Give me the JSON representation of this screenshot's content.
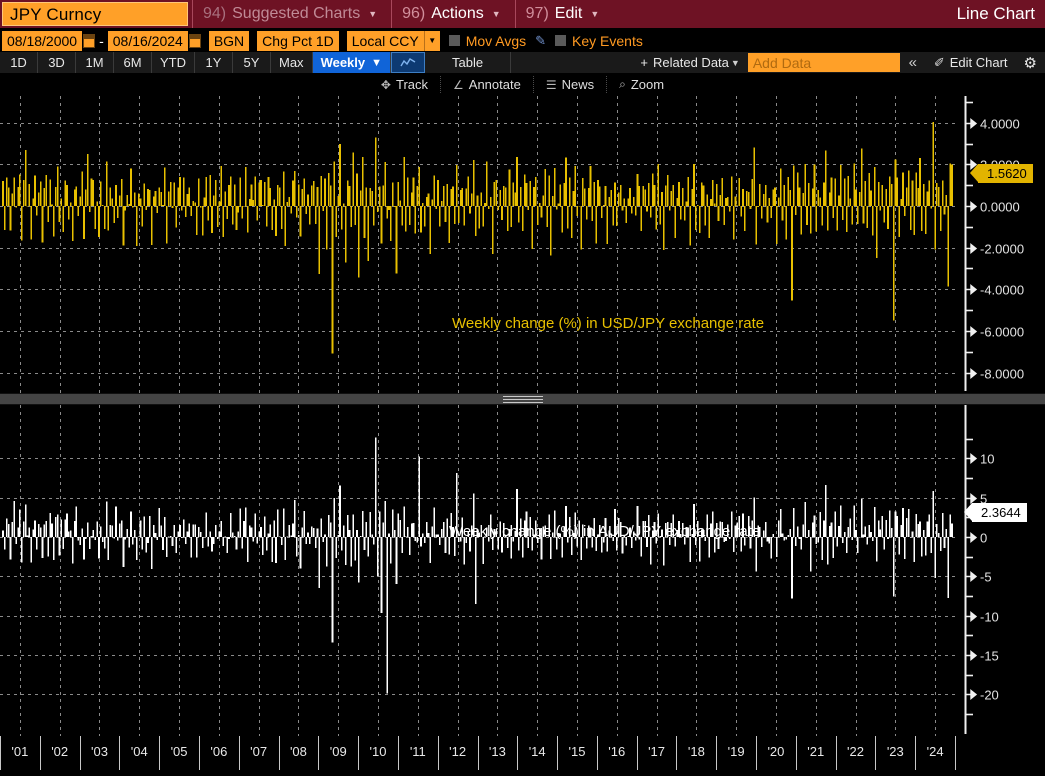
{
  "titlebar": {
    "ticker": "JPY Curncy",
    "items": [
      {
        "num": "94)",
        "label": "Suggested Charts",
        "dim": true,
        "caret": true
      },
      {
        "num": "96)",
        "label": "Actions",
        "dim": false,
        "caret": true
      },
      {
        "num": "97)",
        "label": "Edit",
        "dim": false,
        "caret": true
      }
    ],
    "chart_type": "Line Chart"
  },
  "parambar": {
    "date_from": "08/18/2000",
    "date_to": "08/16/2024",
    "separator": "-",
    "source": "BGN",
    "transform": "Chg Pct 1D",
    "currency": "Local CCY",
    "mov_avgs_label": "Mov Avgs",
    "key_events_label": "Key Events"
  },
  "periodbar": {
    "periods": [
      "1D",
      "3D",
      "1M",
      "6M",
      "YTD",
      "1Y",
      "5Y",
      "Max"
    ],
    "frequency": "Weekly",
    "table_label": "Table",
    "related_data": "Related Data",
    "add_data_placeholder": "Add Data",
    "collapse_label": "«",
    "edit_chart": "Edit Chart"
  },
  "toolbar": {
    "tools": [
      {
        "icon": "crosshair-icon",
        "label": "Track"
      },
      {
        "icon": "annotate-icon",
        "label": "Annotate"
      },
      {
        "icon": "news-icon",
        "label": "News"
      },
      {
        "icon": "zoom-icon",
        "label": "Zoom"
      }
    ]
  },
  "panels": {
    "top": {
      "annotation": "Weekly change (%) in USD/JPY exchange rate",
      "badge_value": "1.5620",
      "badge_color": "#e2b400",
      "series_color": "#e8c000"
    },
    "bottom": {
      "annotation": "Weekly change (%) in AUD/JPY exchange rate",
      "badge_value": "2.3644",
      "badge_color": "#ffffff",
      "series_color": "#ffffff"
    }
  },
  "xaxis": {
    "labels": [
      "'01",
      "'02",
      "'03",
      "'04",
      "'05",
      "'06",
      "'07",
      "'08",
      "'09",
      "'10",
      "'11",
      "'12",
      "'13",
      "'14",
      "'15",
      "'16",
      "'17",
      "'18",
      "'19",
      "'20",
      "'21",
      "'22",
      "'23",
      "'24"
    ]
  },
  "chart_data": [
    {
      "type": "bar",
      "id": "usdjpy-weekly-change",
      "title": "Weekly change (%) in USD/JPY exchange rate",
      "xlabel": "",
      "ylabel": "",
      "ylim": [
        -8.6,
        4.9
      ],
      "yticks": [
        4.0,
        2.0,
        0.0,
        -2.0,
        -4.0,
        -6.0,
        -8.0
      ],
      "ytick_labels": [
        "4.0000",
        "2.0000",
        "0.0000",
        "-2.0000",
        "-4.0000",
        "-6.0000",
        "-8.0000"
      ],
      "grid": true,
      "color": "#e8c000",
      "last_value": 1.562,
      "x_start": "2000-08-18",
      "x_end": "2024-08-16",
      "frequency": "Weekly",
      "categories": [
        "'01",
        "'02",
        "'03",
        "'04",
        "'05",
        "'06",
        "'07",
        "'08",
        "'09",
        "'10",
        "'11",
        "'12",
        "'13",
        "'14",
        "'15",
        "'16",
        "'17",
        "'18",
        "'19",
        "'20",
        "'21",
        "'22",
        "'23",
        "'24"
      ],
      "values": [
        0.6,
        -0.9,
        1.4,
        0.5,
        -1.2,
        0.8,
        1.9,
        -0.4,
        0.3,
        1.1,
        -1.6,
        0.7,
        2.2,
        -0.6,
        0.9,
        -1.3,
        0.4,
        1.7,
        -0.8,
        0.2,
        1.0,
        -2.1,
        0.5,
        1.3,
        -0.7,
        1.8,
        0.3,
        -1.1,
        0.6,
        2.4,
        -0.5,
        0.9,
        -1.4,
        0.7,
        1.2,
        -0.3,
        0.8,
        -1.9,
        0.4,
        1.5,
        -0.6,
        0.2,
        1.1,
        -1.0,
        0.7,
        2.0,
        -0.4,
        0.9,
        1.3,
        -0.8,
        0.5,
        -1.5,
        0.9,
        0.3,
        -0.6,
        1.7,
        -1.1,
        0.4,
        0.8,
        -0.2,
        1.4,
        -0.9,
        0.6,
        1.0,
        -1.8,
        0.3,
        0.7,
        -0.5,
        1.2,
        -0.4,
        0.9,
        -1.3,
        0.5,
        0.8,
        -1.0,
        1.5,
        -0.6,
        0.3,
        1.1,
        -2.2,
        0.7,
        0.4,
        -0.9,
        1.3,
        0.2,
        -0.5,
        1.8,
        -1.2,
        0.6,
        0.9,
        -0.3,
        1.0,
        -1.6,
        0.5,
        0.8,
        -0.7,
        1.4,
        -0.4,
        0.9,
        1.2,
        -1.1,
        0.3,
        0.6,
        -0.8,
        1.5,
        0.2,
        -1.3,
        0.7,
        1.0,
        -0.5,
        0.9,
        -1.7,
        0.4,
        1.1,
        -0.6,
        0.8,
        1.3,
        -0.9,
        0.5,
        -1.2,
        0.7,
        1.6,
        -0.4,
        0.9,
        -1.0,
        0.3,
        1.2,
        -0.7,
        0.5,
        2.1,
        -1.4,
        0.6,
        0.9,
        -0.3,
        1.0,
        -1.1,
        0.8,
        1.4,
        -0.5,
        0.7,
        -0.9,
        1.2,
        0.4,
        -1.6,
        0.8,
        -2.0,
        1.1,
        0.5,
        -0.8,
        1.7,
        -1.3,
        0.6,
        0.9,
        -0.4,
        1.0,
        2.3,
        -0.7,
        0.5,
        -1.5,
        0.8,
        1.2,
        -0.6,
        0.9,
        -1.0,
        0.4,
        1.6,
        -0.8,
        0.7,
        -3.1,
        1.9,
        -0.5,
        0.8,
        -2.4,
        1.1,
        0.6,
        -7.2,
        2.6,
        -1.8,
        0.9,
        3.4,
        -1.2,
        0.7,
        -2.9,
        1.5,
        0.4,
        -1.6,
        2.0,
        -0.8,
        1.2,
        -3.6,
        0.9,
        2.8,
        -1.1,
        0.6,
        -2.2,
        1.4,
        0.8,
        -1.0,
        3.9,
        -0.5,
        1.1,
        -1.9,
        0.7,
        2.1,
        -0.9,
        0.4,
        -1.4,
        1.6,
        0.5,
        -2.7,
        1.0,
        0.8,
        -1.2,
        1.8,
        -0.6,
        0.9,
        -1.5,
        0.7,
        1.3,
        -0.8,
        0.4,
        2.2,
        -1.1,
        0.6,
        -0.9,
        1.0,
        0.3,
        -1.7,
        0.8,
        1.5,
        -0.5,
        0.9,
        -1.2,
        0.6,
        1.1,
        -0.4,
        0.7,
        -2.0,
        1.3,
        0.5,
        -0.8,
        1.9,
        -1.0,
        0.6,
        0.9,
        -1.4,
        0.4,
        1.2,
        -0.7,
        0.8,
        2.5,
        -1.1,
        0.5,
        -0.6,
        1.0,
        -1.3,
        0.7,
        1.6,
        -0.4,
        0.9,
        -1.8,
        0.6,
        1.1,
        -0.5,
        0.8,
        -1.0,
        1.4,
        0.3,
        -0.7,
        1.2,
        -1.5,
        0.6,
        0.9,
        2.8,
        -1.2,
        0.5,
        -0.8,
        1.0,
        1.7,
        -0.4,
        0.7,
        -1.9,
        0.9,
        1.3,
        -0.6,
        0.4,
        -1.1,
        0.8,
        1.5,
        -0.5,
        0.9,
        -2.3,
        0.6,
        1.2,
        -0.8,
        0.3,
        1.0,
        -1.4,
        0.7,
        1.8,
        -0.5,
        0.9,
        -1.0,
        0.4,
        1.3,
        -0.7,
        0.6,
        -1.6,
        1.1,
        0.5,
        -0.9,
        0.8,
        1.4,
        -0.3,
        0.7,
        -1.2,
        0.9,
        1.0,
        -0.6,
        0.4,
        1.5,
        -1.8,
        0.8,
        0.5,
        -1.0,
        1.2,
        -0.4,
        0.9,
        1.6,
        -0.7,
        0.3,
        -1.3,
        0.8,
        1.1,
        -0.5,
        0.6,
        -0.9,
        1.4,
        0.4,
        -1.5,
        0.9,
        1.0,
        -0.6,
        0.7,
        -1.1,
        1.3,
        0.5,
        -0.8,
        1.7,
        -0.4,
        0.9,
        -1.6,
        0.6,
        1.2,
        -0.7,
        0.3,
        1.0,
        -1.2,
        0.8,
        1.5,
        -0.5,
        0.9,
        -0.8,
        0.4,
        1.1,
        -1.4,
        0.7,
        1.8,
        -0.6,
        0.5,
        -1.0,
        0.9,
        1.3,
        -0.4,
        0.8,
        -1.7,
        0.6,
        1.0,
        -0.5,
        1.2,
        -0.9,
        0.7,
        1.6,
        -1.3,
        0.4,
        0.9,
        -0.6,
        1.1,
        -1.5,
        0.8,
        0.5,
        1.4,
        -0.7,
        0.9,
        -1.1,
        0.6,
        1.0,
        -0.4,
        0.7,
        2.4,
        -1.8,
        0.5,
        0.9,
        -1.2,
        0.8,
        1.3,
        -0.6,
        0.4,
        -0.9,
        1.1,
        0.7,
        -1.4,
        0.9,
        1.5,
        -0.5,
        0.6,
        -1.0,
        0.8,
        1.2,
        -4.5,
        2.1,
        -0.8,
        1.6,
        0.5,
        -1.3,
        0.9,
        2.0,
        -0.6,
        1.1,
        -1.7,
        0.7,
        1.4,
        -0.9,
        0.5,
        1.0,
        -1.2,
        0.8,
        3.2,
        -1.5,
        0.6,
        0.9,
        -0.7,
        1.3,
        -1.0,
        0.4,
        1.8,
        -0.5,
        0.8,
        -1.4,
        1.1,
        0.6,
        -0.9,
        1.5,
        0.3,
        -1.1,
        0.9,
        2.2,
        -0.6,
        0.7,
        -1.3,
        1.0,
        0.5,
        -0.8,
        1.6,
        -1.9,
        0.9,
        0.4,
        1.2,
        -0.7,
        0.8,
        -1.0,
        1.4,
        0.6,
        -4.9,
        2.3,
        1.0,
        -1.5,
        0.7,
        1.9,
        -0.9,
        0.5,
        1.3,
        -0.6,
        0.8,
        -1.2,
        1.0,
        0.4,
        1.7,
        -0.8,
        0.9,
        -1.4,
        0.6,
        1.1,
        -0.5,
        3.6,
        -2.6,
        1.2,
        0.8,
        -1.0,
        1.5,
        -0.7,
        0.9,
        -4.3,
        2.0,
        1.562
      ]
    },
    {
      "type": "bar",
      "id": "audjpy-weekly-change",
      "title": "Weekly change (%) in AUD/JPY exchange rate",
      "xlabel": "",
      "ylabel": "",
      "ylim": [
        -23.5,
        15.5
      ],
      "yticks": [
        10,
        5,
        0,
        -5,
        -10,
        -15,
        -20
      ],
      "ytick_labels": [
        "10",
        "5",
        "0",
        "-5",
        "-10",
        "-15",
        "-20"
      ],
      "grid": true,
      "color": "#ffffff",
      "last_value": 2.3644,
      "x_start": "2000-08-18",
      "x_end": "2024-08-16",
      "frequency": "Weekly",
      "categories": [
        "'01",
        "'02",
        "'03",
        "'04",
        "'05",
        "'06",
        "'07",
        "'08",
        "'09",
        "'10",
        "'11",
        "'12",
        "'13",
        "'14",
        "'15",
        "'16",
        "'17",
        "'18",
        "'19",
        "'20",
        "'21",
        "'22",
        "'23",
        "'24"
      ],
      "values": [
        1.2,
        -1.8,
        2.4,
        0.9,
        -2.1,
        1.5,
        3.2,
        -0.8,
        0.6,
        2.0,
        -2.8,
        1.3,
        3.6,
        -1.1,
        1.7,
        -2.3,
        0.8,
        2.9,
        -1.4,
        0.4,
        1.9,
        -3.4,
        0.9,
        2.2,
        -1.3,
        3.0,
        0.6,
        -1.9,
        1.1,
        4.1,
        -0.9,
        1.6,
        -2.4,
        1.2,
        2.1,
        -0.5,
        1.4,
        -3.2,
        0.7,
        2.6,
        -1.0,
        0.4,
        1.9,
        -1.7,
        1.2,
        3.4,
        -0.7,
        1.5,
        2.2,
        -1.4,
        0.9,
        -2.6,
        1.5,
        0.5,
        -1.0,
        2.9,
        -1.9,
        0.7,
        1.4,
        -0.4,
        2.4,
        -1.5,
        1.0,
        1.7,
        -3.0,
        0.5,
        1.2,
        -0.9,
        2.0,
        -0.7,
        1.5,
        -2.2,
        0.9,
        1.4,
        -1.7,
        2.5,
        -1.0,
        0.5,
        1.9,
        -3.7,
        1.2,
        0.7,
        -1.5,
        2.2,
        0.4,
        -0.9,
        3.0,
        -2.0,
        1.0,
        1.5,
        -0.5,
        1.7,
        -2.7,
        0.9,
        1.4,
        -1.2,
        2.4,
        -0.7,
        1.5,
        2.0,
        -1.9,
        0.5,
        1.0,
        -1.4,
        2.5,
        0.4,
        -2.2,
        1.2,
        1.7,
        -0.9,
        1.5,
        -2.9,
        0.7,
        1.9,
        -1.0,
        1.4,
        2.2,
        -1.5,
        0.9,
        -2.0,
        1.2,
        2.7,
        -0.7,
        1.5,
        -1.7,
        0.5,
        2.0,
        -1.2,
        0.9,
        3.5,
        -2.4,
        1.0,
        1.5,
        -0.5,
        1.7,
        -1.9,
        1.4,
        2.4,
        -0.9,
        1.2,
        -1.5,
        2.0,
        0.7,
        -2.7,
        1.4,
        -3.4,
        1.9,
        0.9,
        -1.4,
        2.9,
        -2.2,
        1.0,
        1.5,
        -0.7,
        1.7,
        3.9,
        -1.2,
        0.9,
        -2.5,
        1.4,
        2.0,
        -1.0,
        1.5,
        -1.7,
        0.7,
        2.7,
        -1.4,
        1.2,
        -5.2,
        3.2,
        -0.9,
        1.4,
        -4.0,
        1.9,
        1.0,
        -12.0,
        4.4,
        -3.0,
        1.5,
        5.7,
        -2.0,
        1.2,
        -4.9,
        2.5,
        0.7,
        -2.7,
        3.4,
        -1.4,
        2.0,
        -6.1,
        1.5,
        4.7,
        -1.9,
        1.0,
        -3.7,
        2.4,
        1.4,
        -1.7,
        14.2,
        -5.5,
        2.0,
        -8.2,
        1.2,
        4.0,
        -21.0,
        0.7,
        -2.4,
        2.7,
        0.9,
        -4.6,
        1.7,
        1.4,
        -2.0,
        3.0,
        -1.0,
        1.5,
        -2.5,
        1.2,
        2.2,
        -1.4,
        0.7,
        9.5,
        -1.9,
        1.0,
        -1.5,
        1.7,
        0.5,
        -2.9,
        1.4,
        2.5,
        -0.9,
        1.5,
        -2.0,
        1.0,
        1.9,
        -0.7,
        1.2,
        -3.4,
        2.2,
        0.9,
        -1.4,
        8.2,
        -1.7,
        1.0,
        1.5,
        -2.4,
        0.7,
        2.0,
        -1.2,
        1.4,
        5.3,
        -7.5,
        0.9,
        -1.0,
        1.7,
        -2.2,
        1.2,
        2.7,
        -0.7,
        1.5,
        -3.0,
        1.0,
        1.9,
        -0.9,
        1.4,
        -1.7,
        2.4,
        0.5,
        -1.2,
        2.0,
        -2.5,
        1.0,
        1.5,
        4.8,
        -2.0,
        0.9,
        -1.4,
        1.7,
        2.9,
        -0.7,
        1.2,
        -3.2,
        1.5,
        2.2,
        -1.0,
        0.7,
        -1.9,
        1.4,
        2.5,
        -0.9,
        1.5,
        -3.9,
        1.0,
        2.0,
        -1.4,
        0.5,
        1.7,
        -2.4,
        1.2,
        3.0,
        -0.9,
        1.5,
        -1.7,
        0.7,
        2.2,
        -1.2,
        1.0,
        -2.7,
        1.9,
        0.9,
        -1.5,
        1.4,
        2.4,
        -0.5,
        1.2,
        -2.0,
        1.5,
        1.7,
        -1.0,
        0.7,
        2.5,
        -3.0,
        1.4,
        0.9,
        -1.7,
        2.0,
        -0.7,
        1.5,
        2.7,
        -1.2,
        0.5,
        -2.2,
        1.4,
        1.9,
        -0.9,
        1.0,
        -1.5,
        2.4,
        0.7,
        -2.5,
        1.5,
        1.7,
        -1.0,
        1.2,
        -1.9,
        2.2,
        0.9,
        -1.4,
        2.9,
        -0.7,
        1.5,
        -2.7,
        1.0,
        2.0,
        -1.2,
        0.5,
        1.7,
        -2.0,
        1.4,
        2.5,
        -0.9,
        1.5,
        -1.4,
        0.7,
        1.9,
        -2.4,
        1.2,
        3.0,
        -1.0,
        0.9,
        -1.7,
        1.5,
        2.2,
        -0.7,
        1.4,
        -2.9,
        1.0,
        1.7,
        -0.9,
        2.0,
        -1.5,
        1.2,
        2.7,
        -2.2,
        0.7,
        1.5,
        -1.0,
        1.9,
        -2.5,
        1.4,
        0.9,
        2.4,
        -1.2,
        1.5,
        -1.9,
        1.0,
        1.7,
        -0.7,
        1.2,
        4.0,
        -3.0,
        0.9,
        1.5,
        -2.0,
        1.4,
        2.2,
        -1.0,
        0.7,
        -1.5,
        1.9,
        1.2,
        -2.4,
        1.5,
        2.5,
        -0.9,
        1.0,
        -1.7,
        1.4,
        2.0,
        -7.9,
        3.5,
        -1.4,
        2.7,
        0.9,
        -2.2,
        1.5,
        3.4,
        -1.0,
        1.9,
        -2.9,
        1.2,
        2.4,
        -1.5,
        0.9,
        1.7,
        -2.0,
        1.4,
        5.4,
        -2.5,
        1.0,
        1.5,
        -1.2,
        2.2,
        -1.7,
        0.7,
        3.0,
        -0.9,
        1.4,
        -2.4,
        1.9,
        1.0,
        -1.5,
        2.5,
        0.5,
        -1.9,
        1.5,
        3.7,
        -1.0,
        1.2,
        -2.2,
        1.7,
        0.9,
        -1.4,
        2.7,
        -3.2,
        1.5,
        0.7,
        2.0,
        -1.2,
        1.4,
        -1.7,
        2.4,
        1.0,
        -8.1,
        3.9,
        1.7,
        -2.5,
        1.2,
        3.2,
        -1.5,
        0.9,
        2.2,
        -1.0,
        1.4,
        -2.0,
        1.7,
        0.7,
        2.9,
        -1.4,
        1.5,
        -2.4,
        1.0,
        1.9,
        -0.9,
        6.0,
        -4.4,
        2.0,
        1.4,
        -1.7,
        2.5,
        -1.2,
        1.5,
        -7.2,
        3.4,
        2.3644
      ]
    }
  ]
}
